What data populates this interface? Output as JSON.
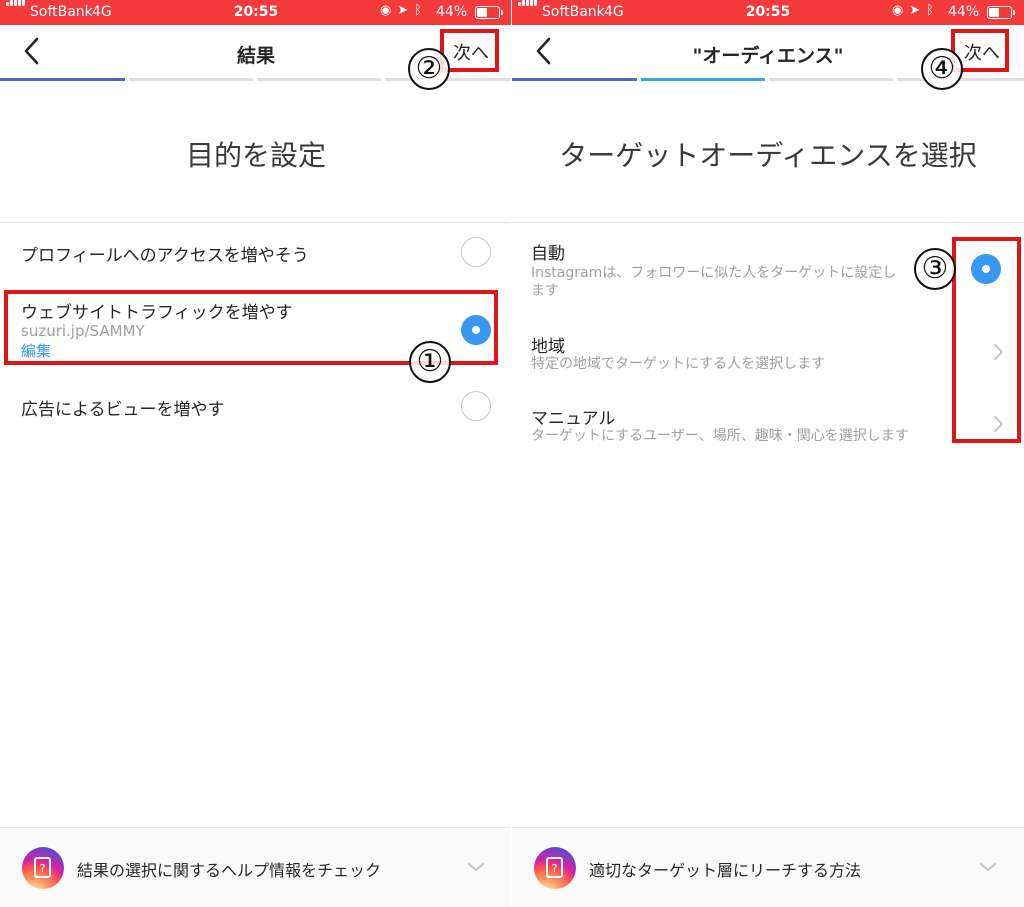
{
  "status": {
    "carrier": "SoftBank",
    "network": "4G",
    "time": "20:55",
    "battery": "44%",
    "battery_level": 0.44,
    "icons": [
      "lock-rotation-icon",
      "location-icon",
      "bluetooth-icon"
    ]
  },
  "colors": {
    "status_bar": "#f43a3a",
    "accent": "#3897f0",
    "annotation": "#e01616"
  },
  "left": {
    "nav": {
      "title": "結果",
      "next_label": "次へ"
    },
    "heading": "目的を設定",
    "options": [
      {
        "label": "プロフィールへのアクセスを増やそう",
        "selected": false
      },
      {
        "label": "ウェブサイトトラフィックを増やす",
        "sub": "suzuri.jp/SAMMY",
        "link": "編集",
        "selected": true
      },
      {
        "label": "広告によるビューを増やす",
        "selected": false
      }
    ],
    "footer": {
      "text": "結果の選択に関するヘルプ情報をチェック"
    },
    "badges": {
      "one": "①",
      "two": "②"
    }
  },
  "right": {
    "nav": {
      "title": "\"オーディエンス\"",
      "next_label": "次へ"
    },
    "heading": "ターゲットオーディエンスを選択",
    "options": [
      {
        "label": "自動",
        "sub1": "Instagramは、フォロワーに似た人をターゲットに設定し",
        "sub2": "ます",
        "selected": true
      },
      {
        "label": "地域",
        "sub": "特定の地域でターゲットにする人を選択します"
      },
      {
        "label": "マニュアル",
        "sub": "ターゲットにするユーザー、場所、趣味・関心を選択します"
      }
    ],
    "footer": {
      "text": "適切なターゲット層にリーチする方法"
    },
    "badges": {
      "three": "③",
      "four": "④"
    }
  }
}
